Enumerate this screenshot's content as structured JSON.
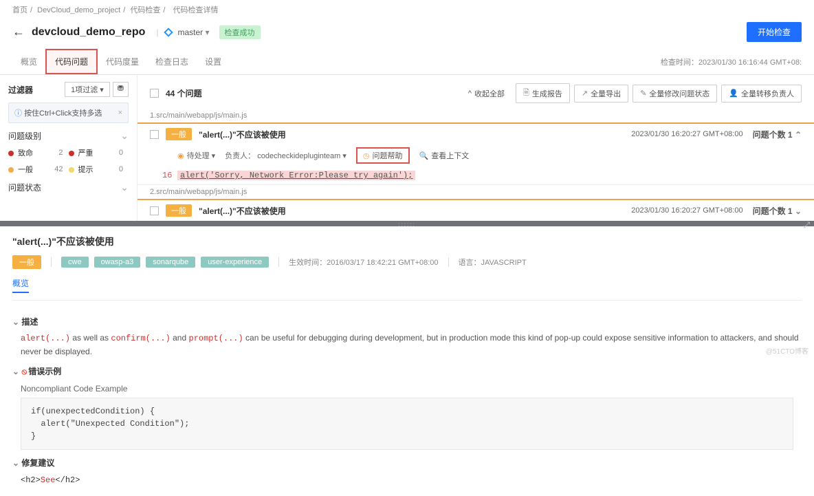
{
  "breadcrumb": {
    "home": "首页",
    "project": "DevCloud_demo_project",
    "check": "代码检查",
    "detail": "代码检查详情"
  },
  "header": {
    "repo": "devcloud_demo_repo",
    "branch": "master",
    "status": "检查成功",
    "start_btn": "开始检查"
  },
  "tabs": {
    "overview": "概览",
    "issues": "代码问题",
    "metrics": "代码度量",
    "logs": "检查日志",
    "settings": "设置",
    "check_time_label": "检查时间：",
    "check_time": "2023/01/30 16:16:44 GMT+08:"
  },
  "sidebar": {
    "filter": "过滤器",
    "filter_sel": "1项过滤",
    "tip": "按住Ctrl+Click支持多选",
    "sev_label": "问题级别",
    "sev": {
      "fatal": "致命",
      "fatal_n": "2",
      "severe": "严重",
      "severe_n": "0",
      "general": "一般",
      "general_n": "42",
      "hint": "提示",
      "hint_n": "0"
    },
    "state_label": "问题状态"
  },
  "issues": {
    "total": "44 个问题",
    "collapse": "收起全部",
    "actions": {
      "report": "生成报告",
      "export": "全量导出",
      "batch_status": "全量修改问题状态",
      "batch_owner": "全量转移负责人"
    },
    "file1": "1.src/main/webapp/js/main.js",
    "file2": "2.src/main/webapp/js/main.js",
    "item": {
      "sev": "一般",
      "title": "\"alert(...)\"不应该被使用",
      "time": "2023/01/30 16:20:27 GMT+08:00",
      "count": "问题个数 1",
      "status": "待处理",
      "owner_label": "负责人：",
      "owner": "codecheckidepluginteam",
      "help": "问题帮助",
      "context": "查看上下文",
      "ln": "16",
      "code": "alert('Sorry, Network Error:Please try again');"
    }
  },
  "detail": {
    "title": "\"alert(...)\"不应该被使用",
    "sev": "一般",
    "tags": [
      "cwe",
      "owasp-a3",
      "sonarqube",
      "user-experience"
    ],
    "eff_label": "生效时间：",
    "eff_time": "2016/03/17 18:42:21 GMT+08:00",
    "lang_label": "语言：",
    "lang": "JAVASCRIPT",
    "overview_tab": "概览",
    "desc_h": "描述",
    "desc_pre": "alert(...)",
    "desc_mid1": " as well as ",
    "desc_code2": "confirm(...)",
    "desc_mid2": " and ",
    "desc_code3": "prompt(...)",
    "desc_rest": " can be useful for debugging during development, but in production mode this kind of pop-up could expose sensitive information to attackers, and should never be displayed.",
    "err_h": "错误示例",
    "err_sub": "Noncompliant Code Example",
    "err_code": "if(unexpectedCondition) {\n  alert(\"Unexpected Condition\");\n}",
    "fix_h": "修复建议",
    "fix_code_pre": "<h2>",
    "fix_code_mid": "See",
    "fix_code_post": "</h2>"
  },
  "watermark": "@51CTO博客"
}
